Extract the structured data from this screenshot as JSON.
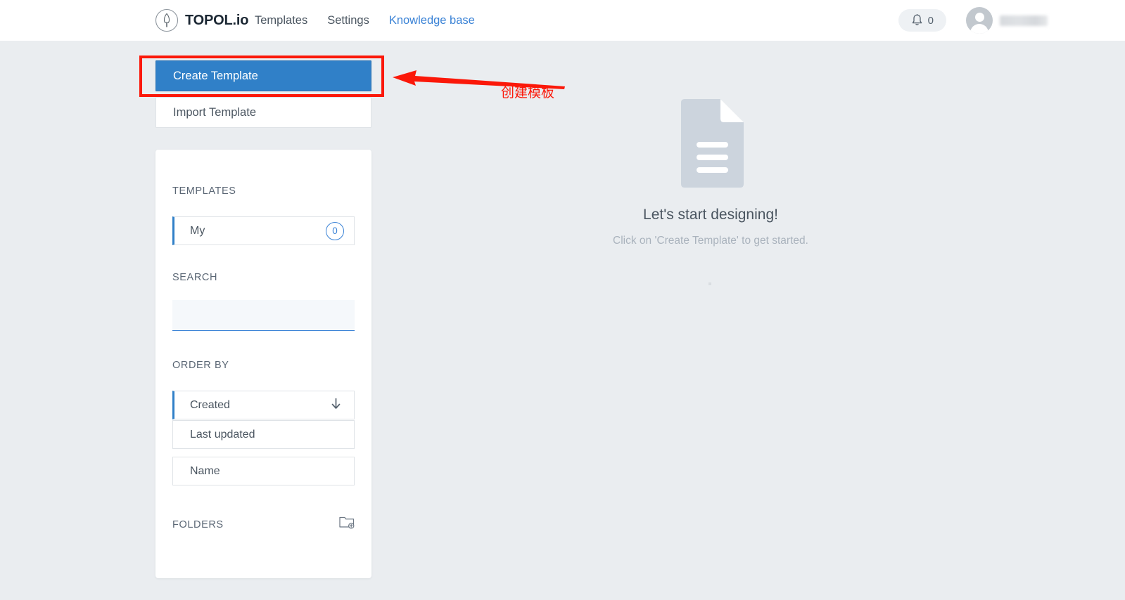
{
  "header": {
    "brand_text": "TOPOL.io",
    "brand_icon": "quill-logo-icon",
    "nav": [
      {
        "label": "Templates",
        "accent": false
      },
      {
        "label": "Settings",
        "accent": false
      },
      {
        "label": "Knowledge base",
        "accent": true
      }
    ],
    "notifications": {
      "icon": "bell-icon",
      "count": "0"
    },
    "user": {
      "avatar_icon": "avatar-icon",
      "name": ""
    }
  },
  "actions": {
    "create_template": "Create Template",
    "import_template": "Import Template"
  },
  "annotation": {
    "text": "创建模板",
    "color": "#fb1809",
    "arrow": "left-arrow-icon"
  },
  "sidebar": {
    "templates": {
      "label": "TEMPLATES",
      "items": [
        {
          "label": "My",
          "count": "0",
          "active": true
        }
      ]
    },
    "search": {
      "label": "SEARCH",
      "value": "",
      "placeholder": ""
    },
    "order_by": {
      "label": "ORDER BY",
      "items": [
        {
          "label": "Created",
          "active": true,
          "direction_icon": "arrow-down-icon"
        },
        {
          "label": "Last updated",
          "active": false
        },
        {
          "label": "Name",
          "active": false
        }
      ]
    },
    "folders": {
      "label": "FOLDERS",
      "add_icon": "add-folder-icon"
    }
  },
  "empty_state": {
    "icon": "document-icon",
    "title": "Let's start designing!",
    "subtitle": "Click on 'Create Template' to get started."
  },
  "colors": {
    "primary": "#3080c8",
    "link": "#3b83d6",
    "annotation": "#fb1809",
    "page_bg": "#eaedf0"
  }
}
